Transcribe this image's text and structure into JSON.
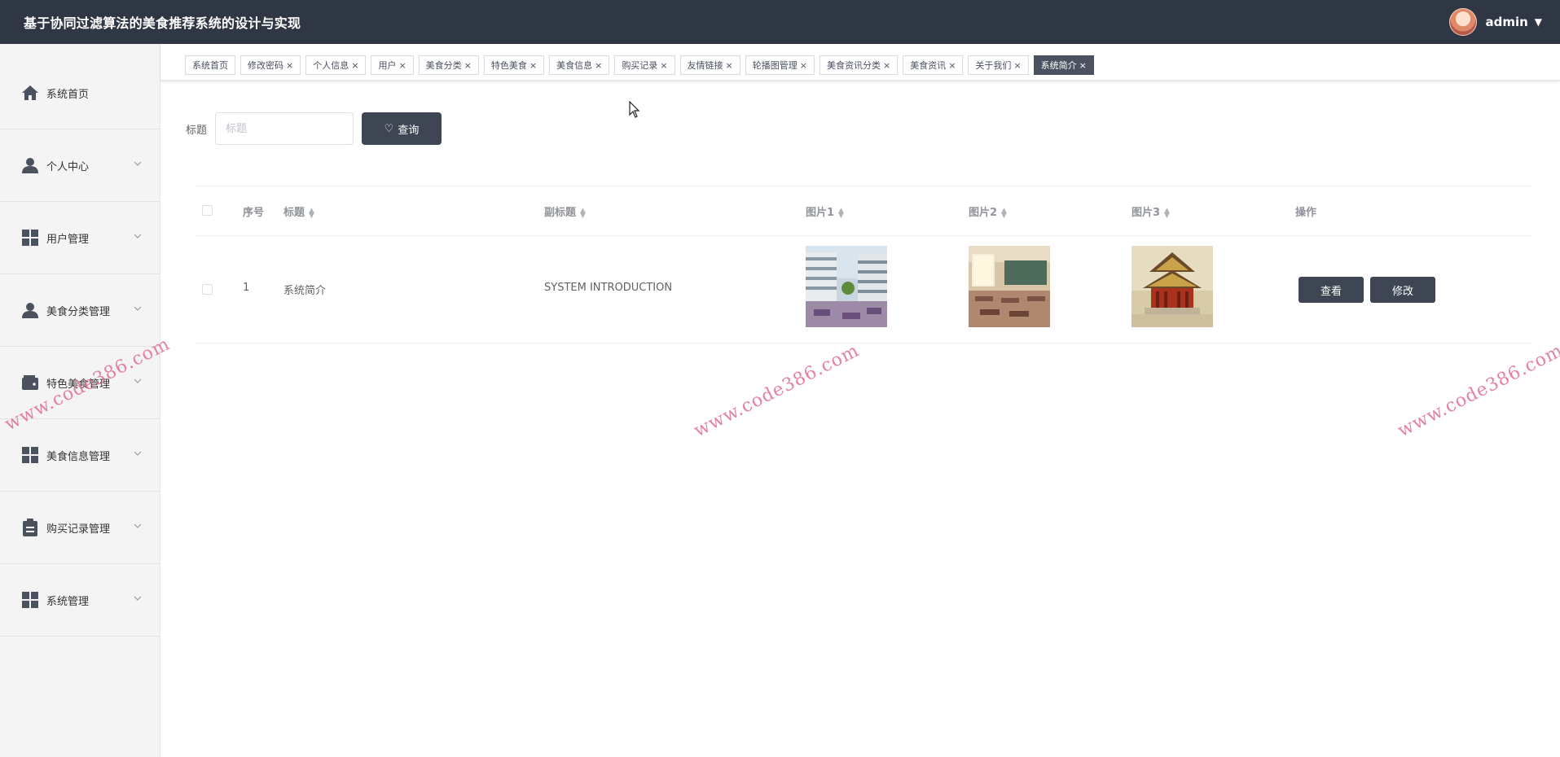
{
  "header": {
    "app_title": "基于协同过滤算法的美食推荐系统的设计与实现",
    "user_name": "admin",
    "caret": "▼",
    "header_bg": "#2e3743"
  },
  "sidebar": {
    "items": [
      {
        "label": "系统首页",
        "icon": "home-icon",
        "has_children": false
      },
      {
        "label": "个人中心",
        "icon": "user-icon",
        "has_children": true
      },
      {
        "label": "用户管理",
        "icon": "grid-icon",
        "has_children": true
      },
      {
        "label": "美食分类管理",
        "icon": "user-icon",
        "has_children": true
      },
      {
        "label": "特色美食管理",
        "icon": "wallet-icon",
        "has_children": true
      },
      {
        "label": "美食信息管理",
        "icon": "grid-icon",
        "has_children": true
      },
      {
        "label": "购买记录管理",
        "icon": "clipboard-icon",
        "has_children": true
      },
      {
        "label": "系统管理",
        "icon": "grid-icon",
        "has_children": true
      }
    ]
  },
  "tabs": [
    {
      "label": "系统首页",
      "closable": false,
      "active": false
    },
    {
      "label": "修改密码",
      "closable": true,
      "active": false
    },
    {
      "label": "个人信息",
      "closable": true,
      "active": false
    },
    {
      "label": "用户",
      "closable": true,
      "active": false
    },
    {
      "label": "美食分类",
      "closable": true,
      "active": false
    },
    {
      "label": "特色美食",
      "closable": true,
      "active": false
    },
    {
      "label": "美食信息",
      "closable": true,
      "active": false
    },
    {
      "label": "购买记录",
      "closable": true,
      "active": false
    },
    {
      "label": "友情链接",
      "closable": true,
      "active": false
    },
    {
      "label": "轮播图管理",
      "closable": true,
      "active": false
    },
    {
      "label": "美食资讯分类",
      "closable": true,
      "active": false
    },
    {
      "label": "美食资讯",
      "closable": true,
      "active": false
    },
    {
      "label": "关于我们",
      "closable": true,
      "active": false
    },
    {
      "label": "系统简介",
      "closable": true,
      "active": true
    }
  ],
  "tab_close_glyph": "×",
  "search": {
    "label": "标题",
    "placeholder": "标题",
    "value": "",
    "button_label": "查询"
  },
  "table": {
    "columns": [
      "序号",
      "标题",
      "副标题",
      "图片1",
      "图片2",
      "图片3",
      "操作"
    ],
    "rows": [
      {
        "index": "1",
        "title": "系统简介",
        "subtitle": "SYSTEM INTRODUCTION",
        "image1": "modern-building-courtyard",
        "image2": "classroom",
        "image3": "chinese-pavilion",
        "actions": [
          "查看",
          "修改"
        ]
      }
    ]
  },
  "watermark": "www.code386.com",
  "accent": "#3d4652"
}
